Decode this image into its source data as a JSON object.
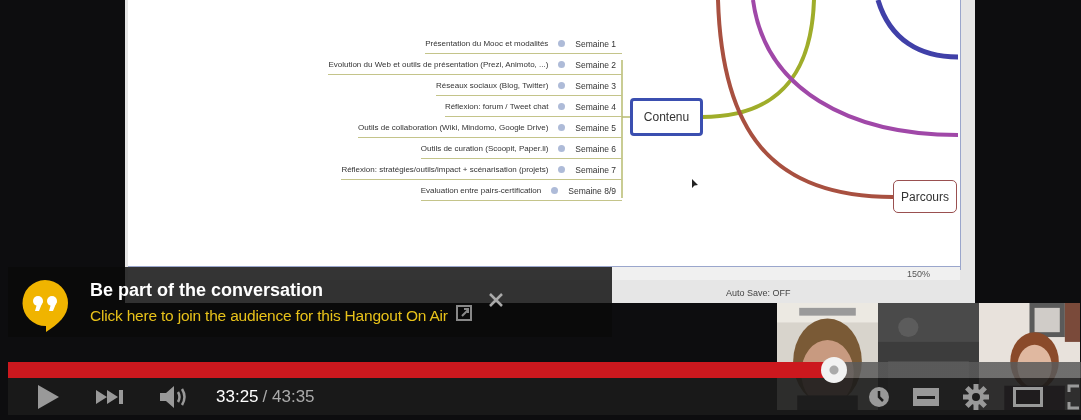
{
  "mindmap": {
    "branches": [
      {
        "label": "Présentation du Mooc et modalités",
        "week": "Semaine 1"
      },
      {
        "label": "Evolution du Web et outils de présentation (Prezi, Animoto, ...)",
        "week": "Semaine 2"
      },
      {
        "label": "Réseaux sociaux (Blog, Twitter)",
        "week": "Semaine 3"
      },
      {
        "label": "Réflexion: forum / Tweet chat",
        "week": "Semaine 4"
      },
      {
        "label": "Outils de collaboration (Wiki, Mindomo, Google Drive)",
        "week": "Semaine 5"
      },
      {
        "label": "Outils de curation  (Scoopit, Paper.li)",
        "week": "Semaine 6"
      },
      {
        "label": "Réflexion: stratégies/outils/impact + scénarisation (projets)",
        "week": "Semaine 7"
      },
      {
        "label": "Evaluation entre pairs-certification",
        "week": "Semaine 8/9"
      }
    ],
    "central_node": "Contenu",
    "other_node": "Parcours",
    "zoom": "150%",
    "autosave": "Auto Save: OFF"
  },
  "hangout_banner": {
    "title": "Be part of the conversation",
    "link": "Click here to join the audience for this Hangout On Air"
  },
  "player": {
    "progress": {
      "level": 0.77
    },
    "current_time": "33:25",
    "duration": "/ 43:35"
  }
}
